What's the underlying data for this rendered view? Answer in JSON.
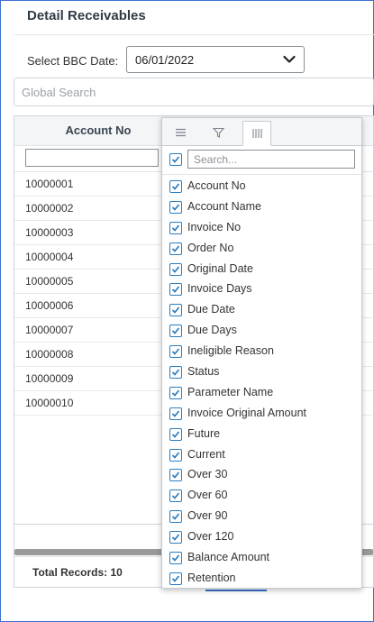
{
  "page": {
    "title": "Detail Receivables"
  },
  "bbc": {
    "label": "Select BBC Date:",
    "value": "06/01/2022"
  },
  "search": {
    "placeholder": "Global Search"
  },
  "grid": {
    "column_header": "Account No",
    "rows": [
      "10000001",
      "10000002",
      "10000003",
      "10000004",
      "10000005",
      "10000006",
      "10000007",
      "10000008",
      "10000009",
      "10000010"
    ],
    "total_label": "Total Records:",
    "total_value": "10"
  },
  "column_menu": {
    "tabs": [
      "menu-icon",
      "filter-icon",
      "columns-icon"
    ],
    "active_tab": "columns-icon",
    "search_placeholder": "Search...",
    "columns": [
      "Account No",
      "Account Name",
      "Invoice No",
      "Order No",
      "Original Date",
      "Invoice Days",
      "Due Date",
      "Due Days",
      "Ineligible Reason",
      "Status",
      "Parameter Name",
      "Invoice Original Amount",
      "Future",
      "Current",
      "Over 30",
      "Over 60",
      "Over 90",
      "Over 120",
      "Balance Amount",
      "Retention"
    ]
  },
  "colors": {
    "accent": "#2a7dc0",
    "frame": "#3a6fd0",
    "header_bg": "#f3f5f7"
  }
}
